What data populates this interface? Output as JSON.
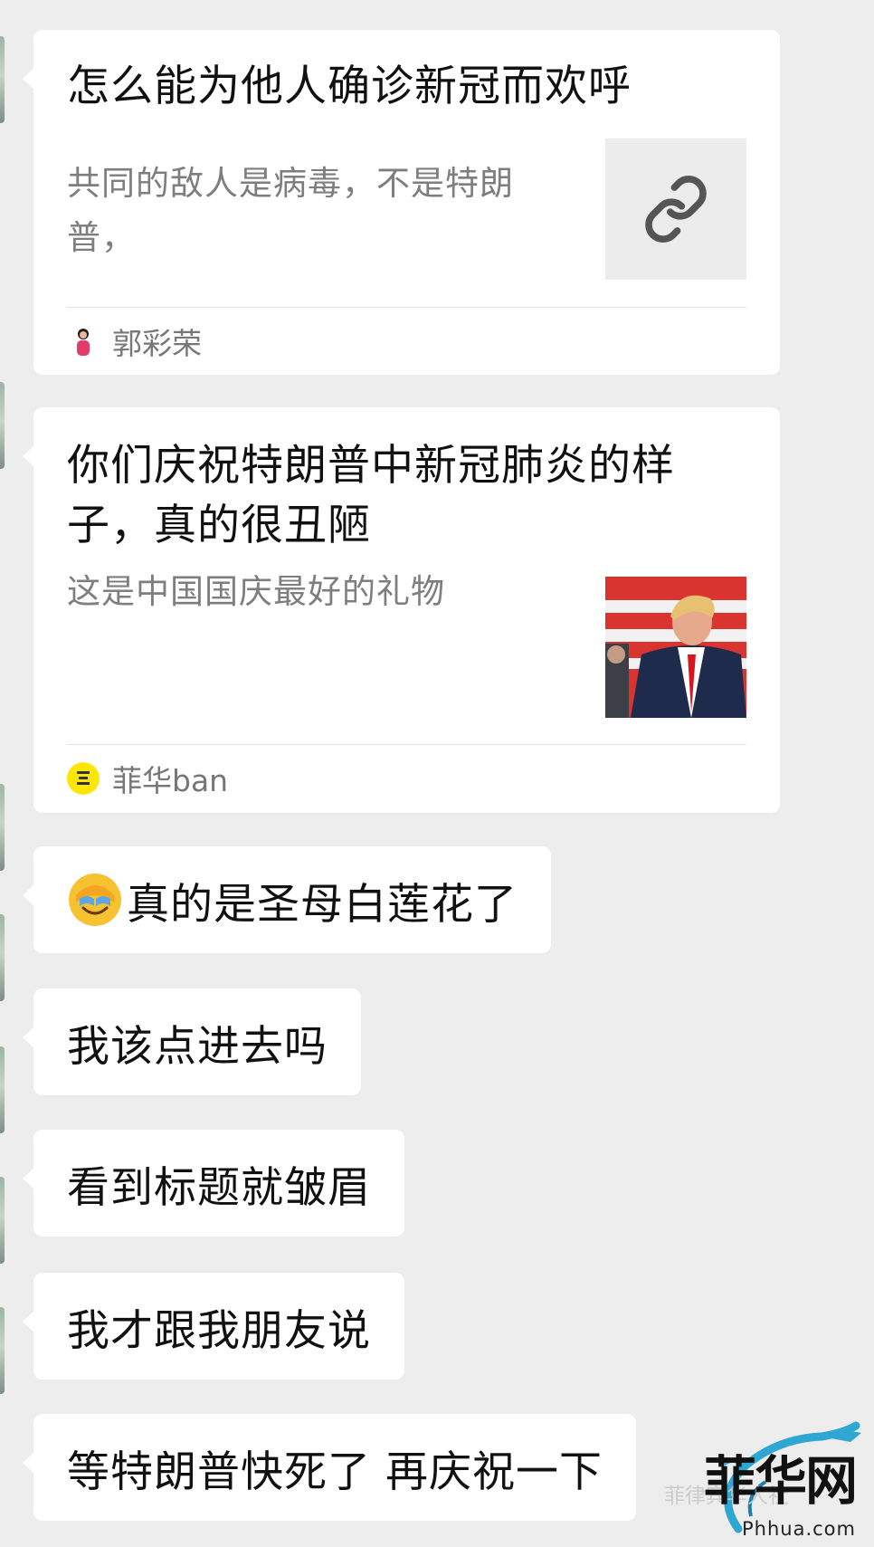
{
  "messages": [
    {
      "type": "link",
      "title": "怎么能为他人确诊新冠而欢呼",
      "description_line1": "共同的敌人是病毒，不是特朗",
      "description_line2": "普，",
      "thumbnail_icon": "link-icon",
      "source_name": "郭彩荣"
    },
    {
      "type": "link",
      "title_line1": "你们庆祝特朗普中新冠肺炎的样",
      "title_line2": "子，真的很丑陋",
      "description": "这是中国国庆最好的礼物",
      "thumbnail_icon": "photo-thumbnail",
      "source_name": "菲华ban"
    },
    {
      "type": "text",
      "emoji": "facepalm-crying-emoji",
      "text": "真的是圣母白莲花了"
    },
    {
      "type": "text",
      "text": "我该点进去吗"
    },
    {
      "type": "text",
      "text": "看到标题就皱眉"
    },
    {
      "type": "text",
      "text": "我才跟我朋友说"
    },
    {
      "type": "text",
      "text": "等特朗普快死了 再庆祝一下"
    }
  ],
  "watermark": {
    "account_text": "菲律宾华人社",
    "site_chars": "菲华网",
    "domain": "Phhua.com"
  },
  "colors": {
    "background": "#ededed",
    "bubble": "#ffffff",
    "secondary_text": "#7e7e7e"
  }
}
